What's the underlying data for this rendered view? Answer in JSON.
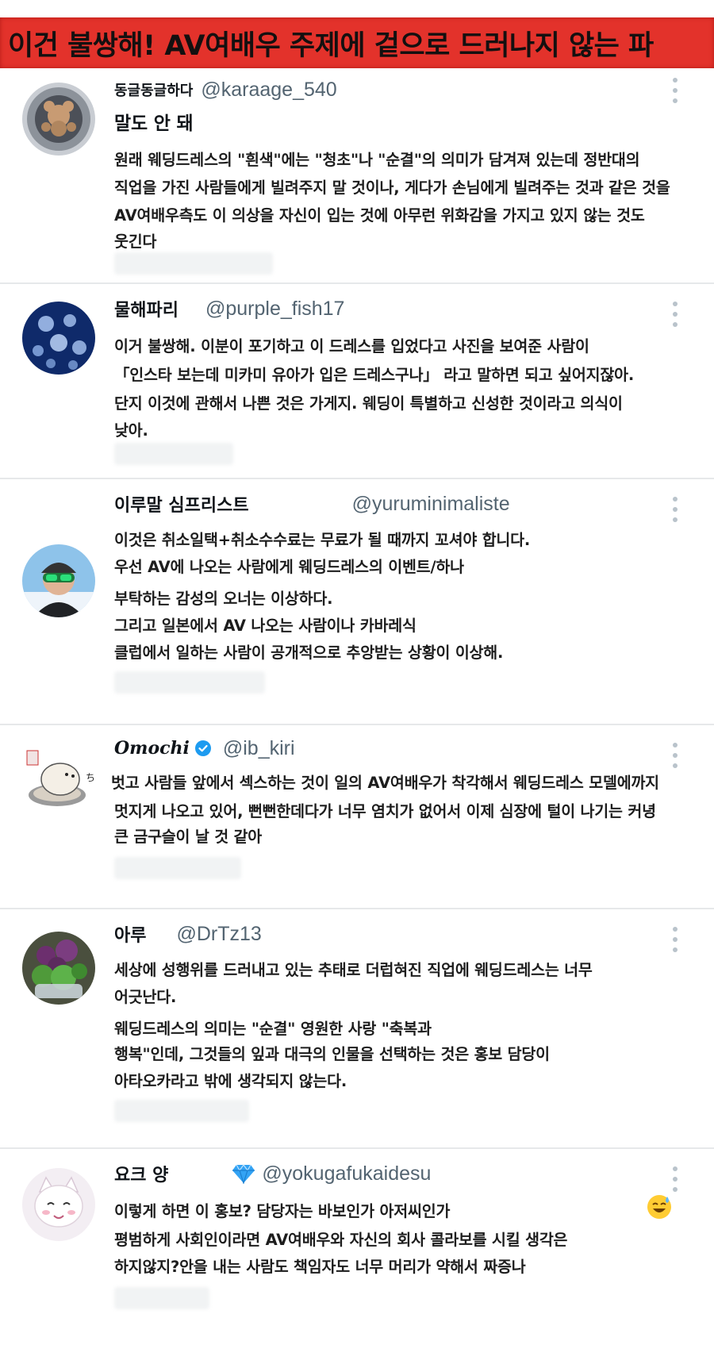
{
  "banner": {
    "title": "이건 불쌍해! AV여배우 주제에 겉으로 드러나지 않는 파"
  },
  "tweets": [
    {
      "display_name": "동글동글하다",
      "handle": "@karaage_540",
      "avatar_icon": "bear-plush-avatar",
      "lines": [
        "말도 안 돼",
        "원래 웨딩드레스의 \"흰색\"에는 \"청초\"나 \"순결\"의 의미가 담겨져 있는데 정반대의",
        "직업을 가진 사람들에게 빌려주지 말 것이나, 게다가 손님에게 빌려주는 것과 같은 것을",
        "AV여배우측도 이 의상을 자신이 입는 것에 아무런 위화감을 가지고 있지 않는 것도",
        "웃긴다"
      ]
    },
    {
      "display_name": "물해파리",
      "handle": "@purple_fish17",
      "avatar_icon": "jellyfish-avatar",
      "lines": [
        "이거 불쌍해. 이분이 포기하고 이 드레스를 입었다고 사진을 보여준 사람이",
        "「인스타 보는데 미카미 유아가 입은 드레스구나」 라고 말하면 되고 싶어지잖아.",
        "단지 이것에 관해서 나쁜 것은 가게지. 웨딩이 특별하고 신성한 것이라고 의식이",
        "낮아."
      ]
    },
    {
      "display_name": "이루말 심프리스트",
      "handle": "@yuruminimaliste",
      "avatar_icon": "skier-goggles-avatar",
      "lines": [
        "이것은 취소일택+취소수수료는 무료가 될 때까지 꼬셔야 합니다.",
        "우선 AV에 나오는 사람에게 웨딩드레스의 이벤트/하나",
        "부탁하는 감성의 오너는 이상하다.",
        "그리고 일본에서 AV 나오는 사람이나 카바레식",
        "클럽에서 일하는 사람이 공개적으로 추앙받는 상황이 이상해."
      ]
    },
    {
      "display_name": "Omochi",
      "handle": "@ib_kiri",
      "avatar_icon": "mochi-bear-avatar",
      "verified_icon": "verified-badge-icon",
      "lines": [
        "벗고 사람들 앞에서 섹스하는 것이 일의 AV여배우가 착각해서 웨딩드레스 모델에까지",
        "멋지게 나오고 있어, 뻔뻔한데다가 너무 염치가 없어서 이제 심장에 털이 나기는 커녕",
        "큰 금구슬이 날 것 같아"
      ]
    },
    {
      "display_name": "아루",
      "handle": "@DrTz13",
      "avatar_icon": "flower-bowl-avatar",
      "lines": [
        "세상에 성행위를 드러내고 있는 추태로 더럽혀진 직업에 웨딩드레스는 너무",
        "어긋난다.",
        "웨딩드레스의 의미는 \"순결\" 영원한 사랑 \"축복과",
        "행복\"인데, 그것들의 잎과 대극의 인물을 선택하는 것은 홍보 담당이",
        "아타오카라고 밖에 생각되지 않는다."
      ]
    },
    {
      "display_name": "요크 양",
      "handle": "@yokugafukaidesu",
      "avatar_icon": "white-cat-avatar",
      "gem_icon": "blue-gem-icon",
      "emoji_icon": "sweat-smile-emoji",
      "lines": [
        "이렇게 하면 이 홍보? 담당자는 바보인가 아저씨인가",
        "평범하게 사회인이라면 AV여배우와 자신의 회사 콜라보를 시킬 생각은",
        "하지않지?안을 내는 사람도 책임자도 너무 머리가 약해서 짜증나"
      ]
    }
  ],
  "colors": {
    "banner": "#e3322b",
    "handle": "#536471",
    "verified": "#1d9bf0",
    "divider": "#e6e8ea"
  }
}
